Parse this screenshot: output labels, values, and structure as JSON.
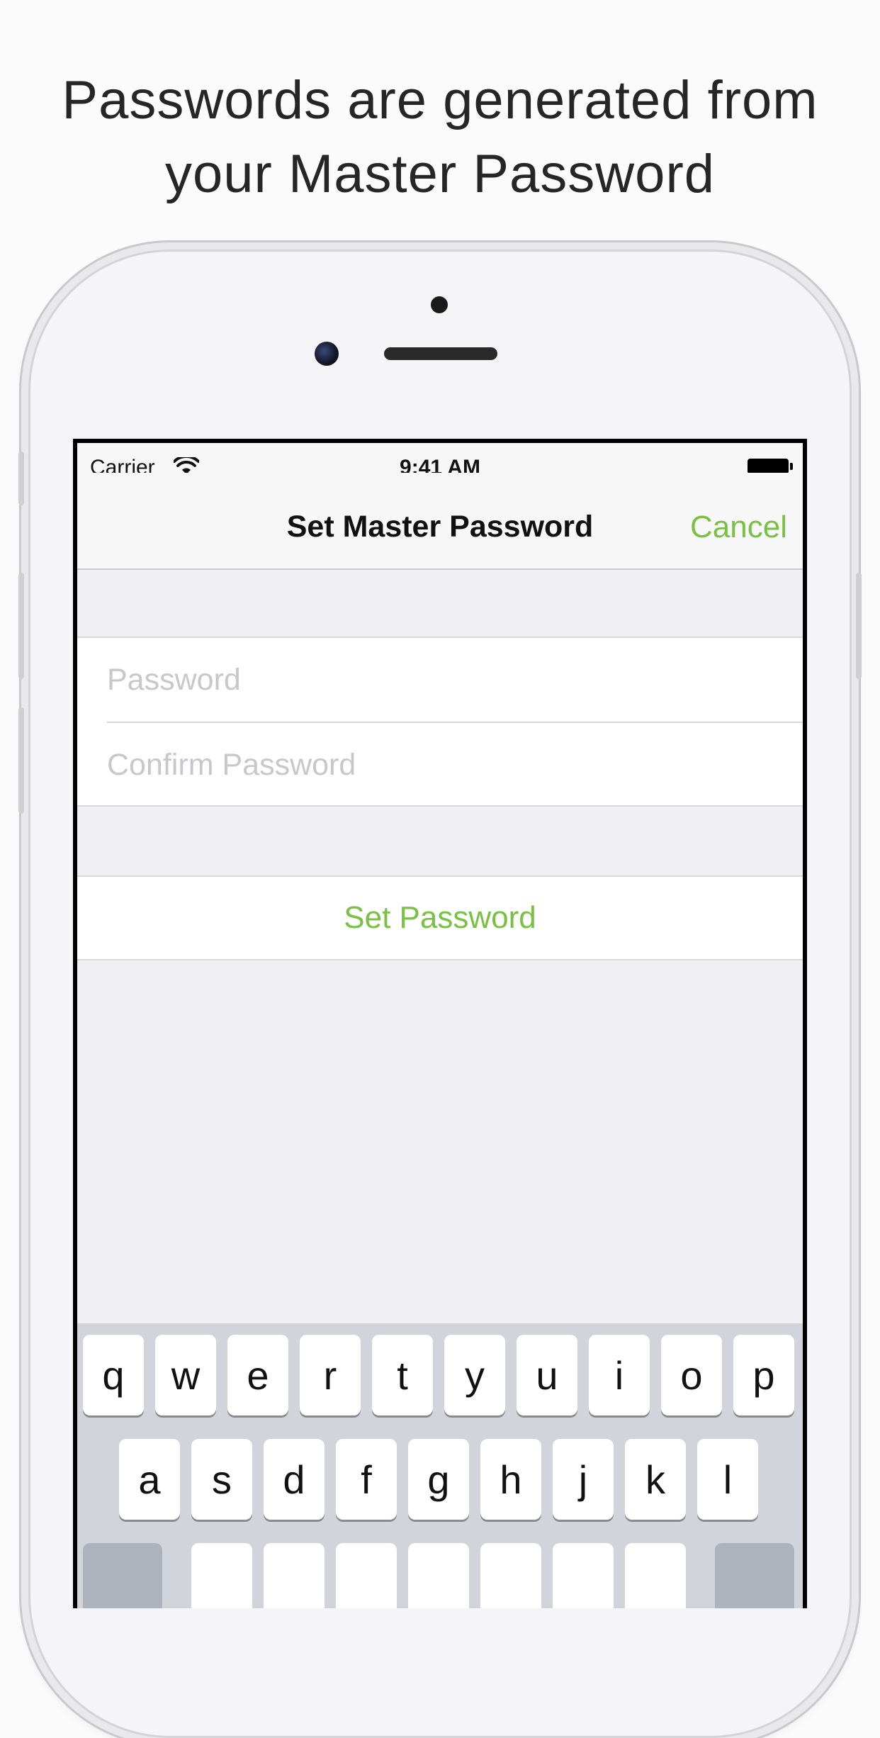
{
  "headline": {
    "line1": "Passwords are generated from",
    "line2": "your Master Password"
  },
  "statusbar": {
    "carrier": "Carrier",
    "time": "9:41 AM",
    "wifi_icon": "wifi-icon",
    "battery_icon": "battery-full-icon"
  },
  "navbar": {
    "title": "Set Master Password",
    "cancel_label": "Cancel"
  },
  "form": {
    "password_placeholder": "Password",
    "password_value": "",
    "confirm_placeholder": "Confirm Password",
    "confirm_value": "",
    "submit_label": "Set Password"
  },
  "keyboard": {
    "row1": [
      "q",
      "w",
      "e",
      "r",
      "t",
      "y",
      "u",
      "i",
      "o",
      "p"
    ],
    "row2": [
      "a",
      "s",
      "d",
      "f",
      "g",
      "h",
      "j",
      "k",
      "l"
    ]
  },
  "colors": {
    "accent": "#79c142",
    "placeholder": "#c7c7cd",
    "background": "#efeff4"
  }
}
